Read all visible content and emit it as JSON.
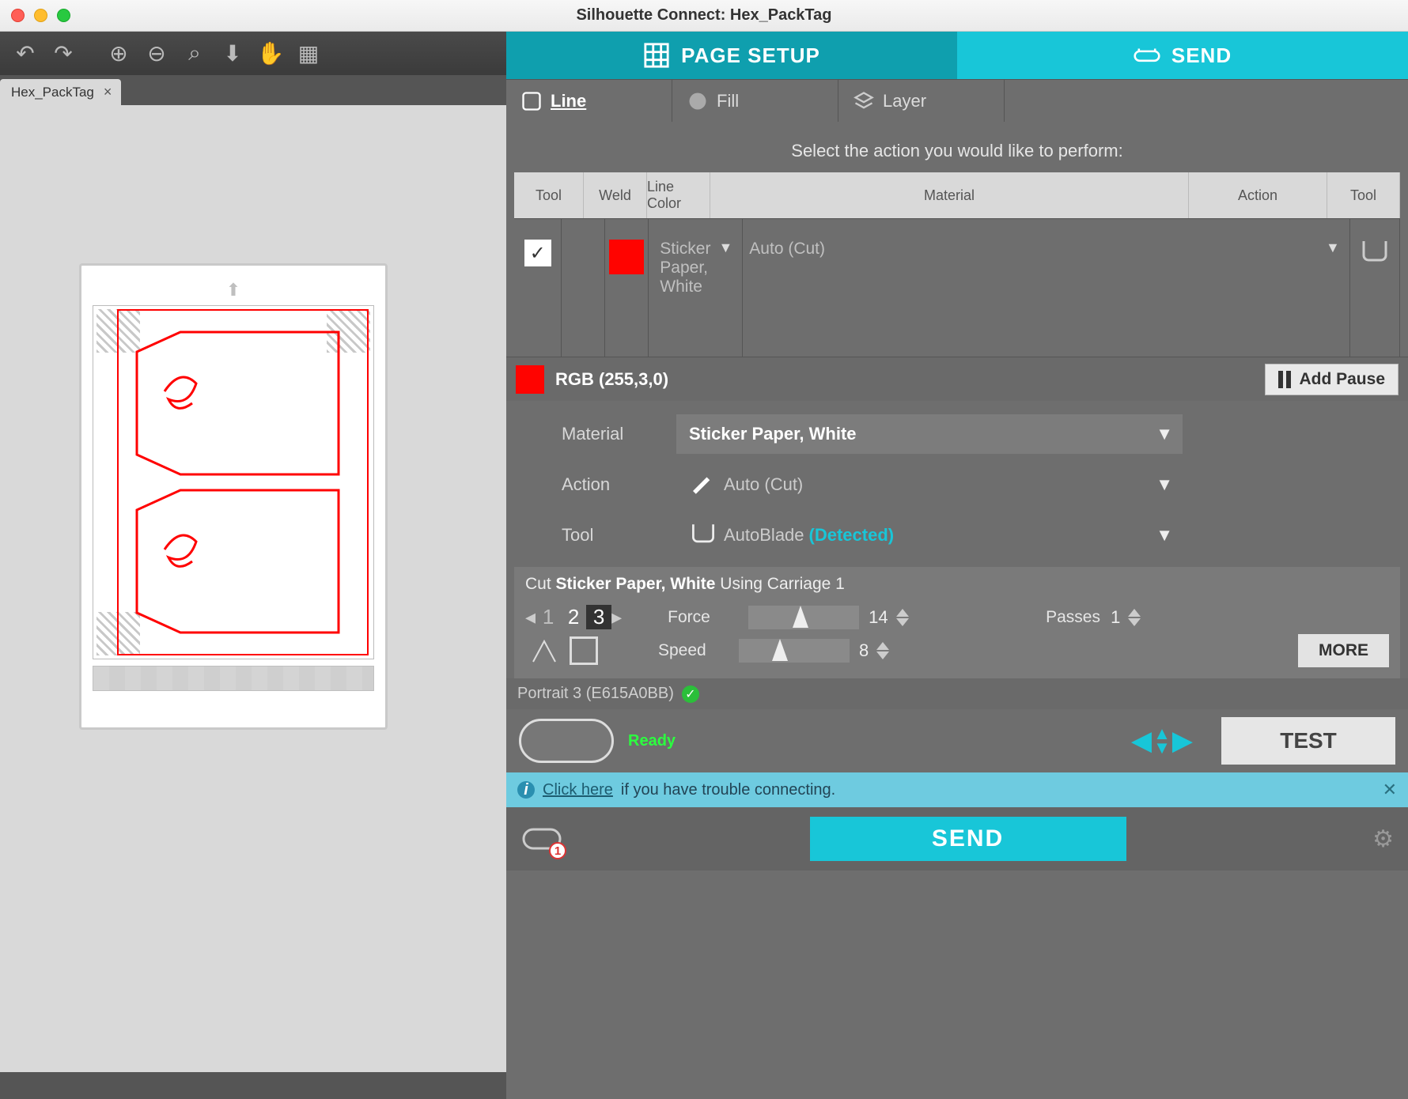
{
  "window": {
    "title": "Silhouette Connect: Hex_PackTag"
  },
  "file_tab": {
    "name": "Hex_PackTag"
  },
  "big_tabs": {
    "page": "PAGE SETUP",
    "send": "SEND"
  },
  "sub_tabs": {
    "line": "Line",
    "fill": "Fill",
    "layer": "Layer"
  },
  "prompt": "Select the action you would like to perform:",
  "table": {
    "headers": {
      "tool": "Tool",
      "weld": "Weld",
      "color": "Line Color",
      "material": "Material",
      "action": "Action",
      "tool2": "Tool"
    },
    "row": {
      "material": "Sticker Paper, White",
      "action": "Auto (Cut)"
    }
  },
  "color_section": {
    "swatch_hex": "#ff0300",
    "label": "RGB (255,3,0)",
    "add_pause": "Add Pause",
    "material_key": "Material",
    "material_val": "Sticker Paper, White",
    "action_key": "Action",
    "action_val": "Auto (Cut)",
    "tool_key": "Tool",
    "tool_val": "AutoBlade",
    "tool_detected": "(Detected)"
  },
  "cut_panel": {
    "prefix": "Cut ",
    "material": "Sticker Paper, White",
    "suffix": " Using Carriage 1",
    "blade_nums": [
      "1",
      "2",
      "3"
    ],
    "force_label": "Force",
    "force_val": "14",
    "speed_label": "Speed",
    "speed_val": "8",
    "passes_label": "Passes",
    "passes_val": "1",
    "more": "MORE"
  },
  "device": {
    "name": "Portrait 3 (E615A0BB)",
    "status": "Ready",
    "test": "TEST"
  },
  "info": {
    "link": "Click here",
    "rest": " if you have trouble connecting."
  },
  "send": {
    "label": "SEND",
    "badge": "1"
  }
}
